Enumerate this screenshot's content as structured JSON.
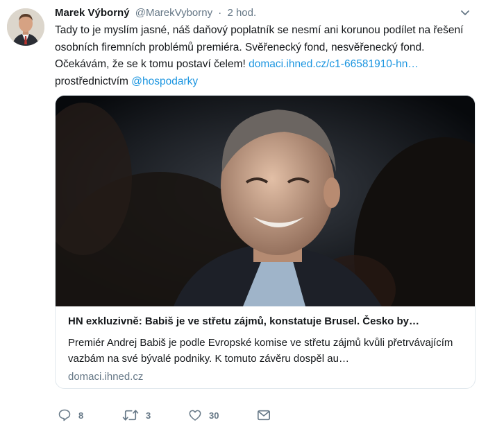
{
  "tweet": {
    "author_name": "Marek Výborný",
    "author_handle": "@MarekVyborny",
    "separator": "·",
    "time": "2 hod.",
    "text_part1": "Tady to je myslím jasné, náš daňový poplatník se nesmí ani korunou podílet na řešení osobních firemních problémů premiéra. Svěřenecký fond, nesvěřenecký fond. Očekávám, že se k tomu postaví čelem!",
    "link_text": "domaci.ihned.cz/c1-66581910-hn…",
    "via_text": "prostřednictvím",
    "mention": "@hospodarky"
  },
  "card": {
    "title": "HN exkluzivně: Babiš je ve střetu zájmů, konstatuje Brusel. Česko by…",
    "description": "Premiér Andrej Babiš je podle Evropské komise ve střetu zájmů kvůli přetrvávajícím vazbám na své bývalé podniky. K tomuto závěru dospěl au…",
    "domain": "domaci.ihned.cz"
  },
  "actions": {
    "replies": "8",
    "retweets": "3",
    "likes": "30"
  },
  "icons": [
    "chevron-down-icon",
    "reply-icon",
    "retweet-icon",
    "like-icon",
    "message-icon"
  ],
  "colors": {
    "link": "#1b95e0",
    "muted": "#657786",
    "text": "#14171a",
    "border": "#e1e8ed"
  }
}
